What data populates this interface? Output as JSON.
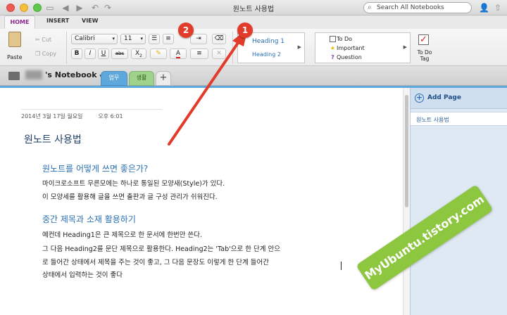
{
  "window": {
    "title": "원노트 사용법",
    "search_placeholder": "Search All Notebooks"
  },
  "ribbon_tabs": [
    "HOME",
    "INSERT",
    "VIEW"
  ],
  "ribbon": {
    "paste_label": "Paste",
    "cut_label": "Cut",
    "copy_label": "Copy",
    "font_name": "Calibri",
    "font_size": "11",
    "bold": "B",
    "italic": "I",
    "underline": "U",
    "strike": "abc",
    "subscript": "X",
    "styles": [
      "Heading 1",
      "Heading 2"
    ],
    "tags": [
      "To Do",
      "Important",
      "Question"
    ],
    "todo_tag_label": "To Do Tag"
  },
  "notebook": {
    "name_suffix": "'s Notebook",
    "sections": [
      "업무",
      "생활"
    ],
    "add_section": "+"
  },
  "sidebar": {
    "add_page": "Add Page",
    "pages": [
      "원노트 사용법"
    ]
  },
  "page": {
    "date": "2014년 3월 17일 월요일",
    "time": "오후 6:01",
    "title": "원노트 사용법",
    "heading1": "원노트를 어떻게 쓰면 좋은가?",
    "para1_line1": "마이크로소프트 무른모에는 하나로 통일된 모양새(Style)가 있다.",
    "para1_line2": "이 모양세를 활용해 글을 쓰면 출판과 글 구성 관리가 쉬워진다.",
    "heading2": "중간 제목과 소재 활용하기",
    "para2_line1": "예컨데 Heading1은 큰 제목으로 한 문서에 한번만 쓴다.",
    "para2_line2": "그 다음 Heading2를 문단 제목으로 활용한다. Heading2는 'Tab'으로 한 단계 안으",
    "para2_line3": "로 들어간 상태에서 제목을 주는 것이 좋고, 그 다음 문장도 이렇게 한 단계 들어간",
    "para2_line4": "상태에서 입력하는 것이 좋다"
  },
  "annotations": {
    "badge1": "1",
    "badge2": "2",
    "watermark": "MyUbuntu.tistory.com",
    "arrow_color": "#e23b2a"
  },
  "colors": {
    "accent_purple": "#8b2a8a",
    "section_blue": "#5fa8dc",
    "section_green": "#9fd28a",
    "heading_blue": "#2a6fb1"
  }
}
